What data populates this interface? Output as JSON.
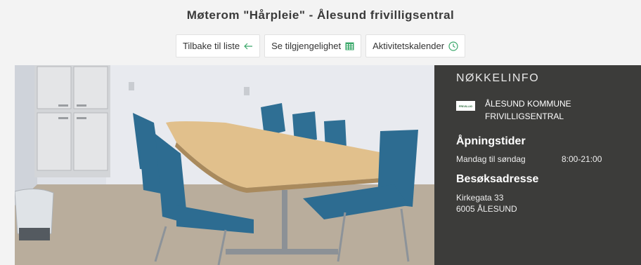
{
  "page": {
    "title": "Møterom \"Hårpleie\" - Ålesund frivilligsentral"
  },
  "buttons": {
    "back_label": "Tilbake til liste",
    "back_icon": "arrow-left-icon",
    "availability_label": "Se tilgjengelighet",
    "availability_icon": "calendar-grid-icon",
    "activity_label": "Aktivitetskalender",
    "activity_icon": "clock-icon"
  },
  "info": {
    "heading": "NØKKELINFO",
    "org_line1": "ÅLESUND KOMMUNE",
    "org_line2": "FRIVILLIGSENTRAL",
    "logo_text": "FRIVILLIG",
    "hours_heading": "Åpningstider",
    "hours_days": "Mandag til søndag",
    "hours_time": "8:00-21:00",
    "address_heading": "Besøksadresse",
    "address_street": "Kirkegata 33",
    "address_city": "6005 ÅLESUND"
  },
  "colors": {
    "accent": "#3aa86a",
    "panel_bg": "#3c3c3a"
  }
}
